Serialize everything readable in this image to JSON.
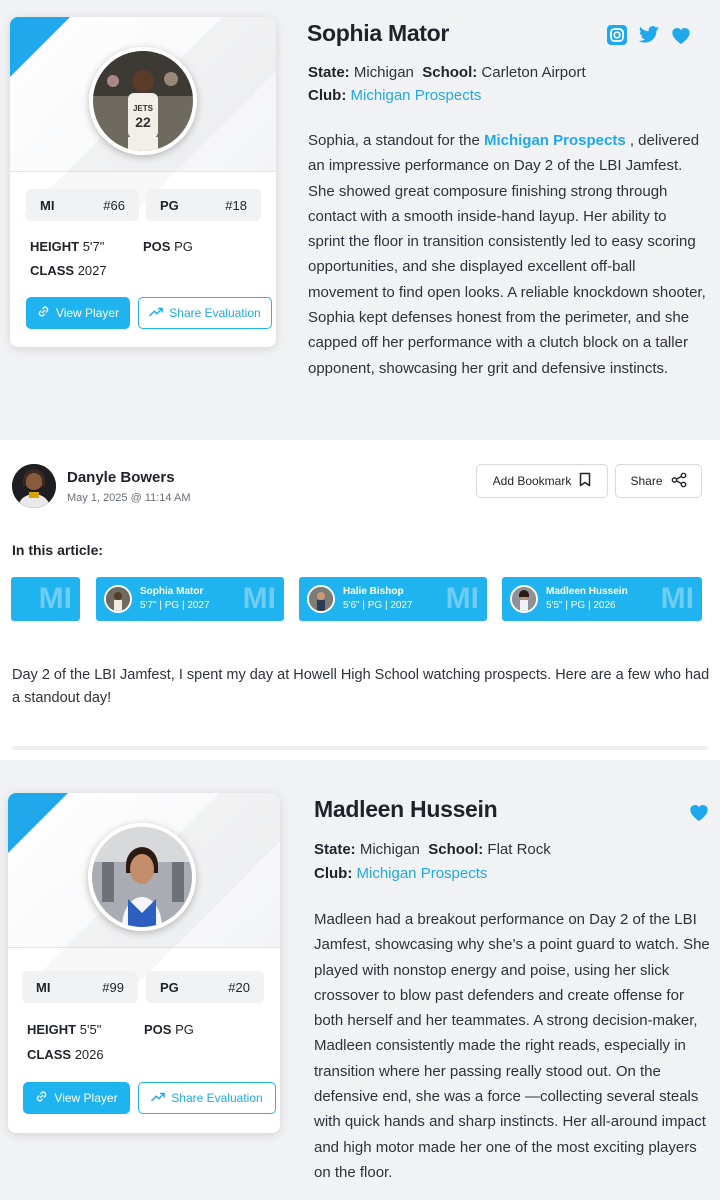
{
  "players": [
    {
      "name": "Sophia Mator",
      "state_label": "State:",
      "state": "Michigan",
      "school_label": "School:",
      "school": "Carleton Airport",
      "club_label": "Club:",
      "club": "Michigan Prospects",
      "chip1_left": "MI",
      "chip1_right": "#66",
      "chip2_left": "PG",
      "chip2_right": "#18",
      "height_label": "HEIGHT",
      "height": "5'7\"",
      "pos_label": "POS",
      "pos": "PG",
      "class_label": "CLASS",
      "class": "2027",
      "view_label": "View Player",
      "share_label": "Share Evaluation",
      "bio_pre": "Sophia, a standout for the ",
      "bio_link": "Michigan Prospects",
      "bio_post": " , delivered an impressive performance on Day 2 of the LBI Jamfest. She showed great composure finishing strong through contact with a smooth inside-hand layup. Her ability to sprint the floor in transition consistently led to easy scoring opportunities, and she displayed excellent off-ball movement to find open looks. A reliable knockdown shooter, Sophia kept defenses honest from the perimeter, and she capped off her performance with a clutch block on a taller opponent, showcasing her grit and defensive instincts."
    },
    {
      "name": "Madleen Hussein",
      "state_label": "State:",
      "state": "Michigan",
      "school_label": "School:",
      "school": "Flat Rock",
      "club_label": "Club:",
      "club": "Michigan Prospects",
      "chip1_left": "MI",
      "chip1_right": "#99",
      "chip2_left": "PG",
      "chip2_right": "#20",
      "height_label": "HEIGHT",
      "height": "5'5\"",
      "pos_label": "POS",
      "pos": "PG",
      "class_label": "CLASS",
      "class": "2026",
      "view_label": "View Player",
      "share_label": "Share Evaluation",
      "bio": "Madleen had a breakout performance on Day 2 of the LBI Jamfest, showcasing why she’s a point guard to watch. She played with nonstop energy and poise, using her slick crossover to blow past defenders and create offense for both herself and her teammates. A strong decision-maker, Madleen consistently made the right reads, especially in transition where her passing really stood out. On the defensive end, she was a force —collecting several steals with quick hands and sharp instincts. Her all-around impact and high motor made her one of the most exciting players on the floor."
    }
  ],
  "article": {
    "author": "Danyle Bowers",
    "date": "May 1, 2025 @ 11:14 AM",
    "bookmark_label": "Add Bookmark",
    "share_label": "Share",
    "in_article_label": "In this article:",
    "tag_state": "MI",
    "tags": [
      {
        "name": "Sophia Mator",
        "stats": "5'7\" | PG | 2027"
      },
      {
        "name": "Halie Bishop",
        "stats": "5'6\" | PG | 2027"
      },
      {
        "name": "Madleen Hussein",
        "stats": "5'5\" | PG | 2026"
      }
    ],
    "intro": "Day 2 of the LBI Jamfest, I spent my day at Howell High School watching prospects. Here are a few who had a standout day!"
  },
  "colors": {
    "accent": "#1fb3f0",
    "link": "#1fa9ec",
    "background": "#f1f2f4"
  },
  "icons": [
    "instagram-icon",
    "twitter-icon",
    "heart-icon",
    "link-icon",
    "trend-icon",
    "bookmark-icon",
    "share-icon"
  ]
}
